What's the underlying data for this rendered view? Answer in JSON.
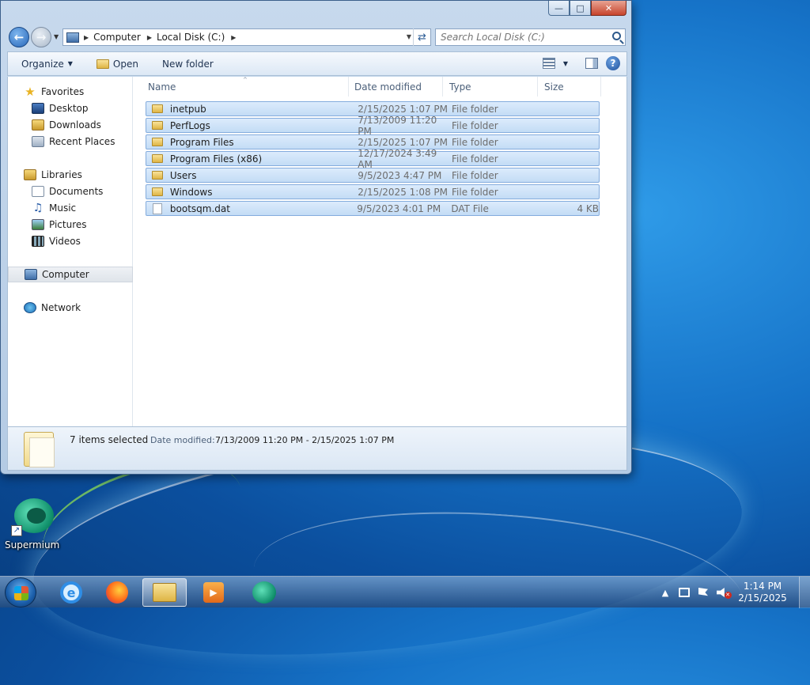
{
  "window": {
    "title_buttons": [
      "minimize",
      "maximize",
      "close"
    ],
    "navigation": {
      "back_icon": "back-arrow-icon",
      "forward_icon": "forward-arrow-icon"
    },
    "address": {
      "crumbs": [
        "Computer",
        "Local Disk (C:)"
      ]
    },
    "search": {
      "placeholder": "Search Local Disk (C:)"
    },
    "toolbar": {
      "organize": "Organize",
      "open": "Open",
      "new_folder": "New folder"
    },
    "nav_pane": {
      "favorites": "Favorites",
      "desktop": "Desktop",
      "downloads": "Downloads",
      "recent_places": "Recent Places",
      "libraries": "Libraries",
      "documents": "Documents",
      "music": "Music",
      "pictures": "Pictures",
      "videos": "Videos",
      "computer": "Computer",
      "network": "Network"
    },
    "columns": {
      "name": "Name",
      "date_modified": "Date modified",
      "type": "Type",
      "size": "Size"
    },
    "files": [
      {
        "name": "inetpub",
        "date": "2/15/2025 1:07 PM",
        "type": "File folder",
        "size": "",
        "selected": true,
        "kind": "folder"
      },
      {
        "name": "PerfLogs",
        "date": "7/13/2009 11:20 PM",
        "type": "File folder",
        "size": "",
        "selected": true,
        "kind": "folder"
      },
      {
        "name": "Program Files",
        "date": "2/15/2025 1:07 PM",
        "type": "File folder",
        "size": "",
        "selected": true,
        "kind": "folder"
      },
      {
        "name": "Program Files (x86)",
        "date": "12/17/2024 3:49 AM",
        "type": "File folder",
        "size": "",
        "selected": true,
        "kind": "folder"
      },
      {
        "name": "Users",
        "date": "9/5/2023 4:47 PM",
        "type": "File folder",
        "size": "",
        "selected": true,
        "kind": "folder"
      },
      {
        "name": "Windows",
        "date": "2/15/2025 1:08 PM",
        "type": "File folder",
        "size": "",
        "selected": true,
        "kind": "folder"
      },
      {
        "name": "bootsqm.dat",
        "date": "9/5/2023 4:01 PM",
        "type": "DAT File",
        "size": "4 KB",
        "selected": true,
        "kind": "file"
      }
    ],
    "details": {
      "count": "7 items selected",
      "date_label": "Date modified:",
      "date_value": "7/13/2009 11:20 PM - 2/15/2025 1:07 PM"
    }
  },
  "desktop": {
    "icon_label": "Supermium"
  },
  "taskbar": {
    "time": "1:14 PM",
    "date": "2/15/2025"
  }
}
